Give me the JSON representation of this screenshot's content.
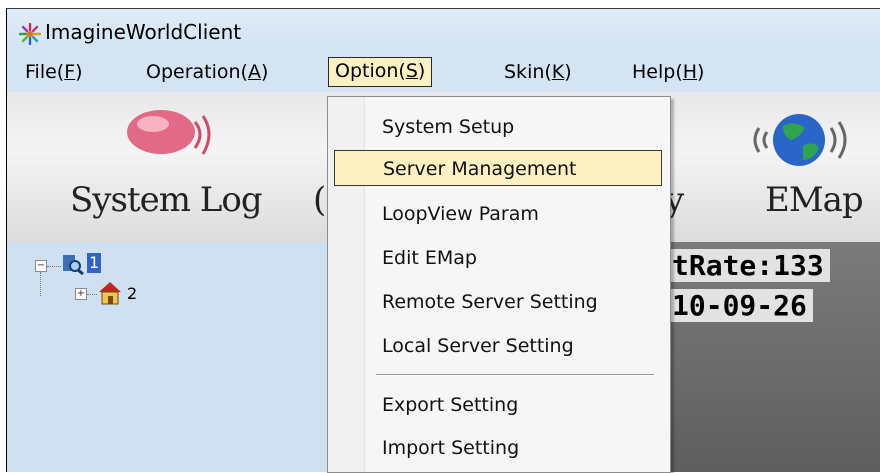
{
  "window": {
    "title": "ImagineWorldClient"
  },
  "menubar": [
    {
      "label": "File(",
      "key": "F"
    },
    {
      "label": "Operation(",
      "key": "A"
    },
    {
      "label": "Option(",
      "key": "S"
    },
    {
      "label": "Skin(",
      "key": "K"
    },
    {
      "label": "Help(",
      "key": "H"
    }
  ],
  "toolbar": {
    "system_log": "System Log",
    "emap": "EMap"
  },
  "tree": {
    "root_label": "1",
    "child_label": "2"
  },
  "video": {
    "line1": "tRate:133",
    "line2": "10-09-26"
  },
  "option_menu": {
    "items": [
      "System Setup",
      "Server Management",
      "LoopView Param",
      "Edit EMap",
      "Remote Server Setting",
      "Local Server Setting",
      "Export Setting",
      "Import Setting"
    ],
    "highlighted": "Server Management"
  },
  "colors": {
    "highlight": "#fdf1c4",
    "window_bg": "#cfe0f1"
  }
}
